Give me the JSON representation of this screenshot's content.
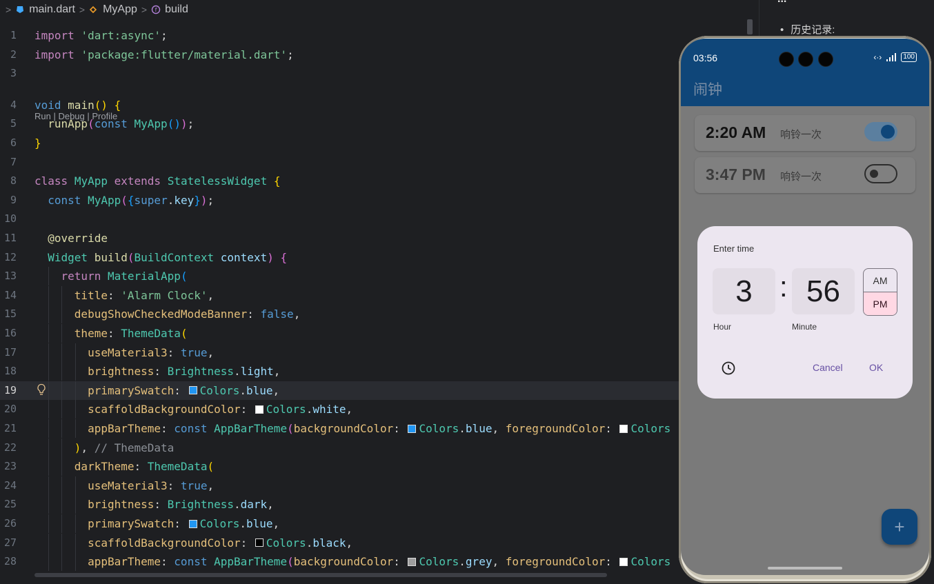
{
  "breadcrumb": {
    "file": "main.dart",
    "class": "MyApp",
    "method": "build"
  },
  "codelens": "Run | Debug | Profile",
  "doc_panel": {
    "heading": "...",
    "history": "历史记录:"
  },
  "lines": [
    {
      "n": "1",
      "html": "<span class='kw'>import</span> <span class='str'>'dart:async'</span>;"
    },
    {
      "n": "2",
      "html": "<span class='kw'>import</span> <span class='str'>'package:flutter/material.dart'</span>;"
    },
    {
      "n": "3",
      "html": ""
    },
    {
      "n": "4",
      "html": "<span class='kw2'>void</span> <span class='fn'>main</span><span class='p1'>()</span> <span class='p1'>{</span>"
    },
    {
      "n": "5",
      "html": "  <span class='fn'>runApp</span><span class='p2'>(</span><span class='kw2'>const</span> <span class='cls'>MyApp</span><span class='p3'>()</span><span class='p2'>)</span>;"
    },
    {
      "n": "6",
      "html": "<span class='p1'>}</span>"
    },
    {
      "n": "7",
      "html": ""
    },
    {
      "n": "8",
      "html": "<span class='kw'>class</span> <span class='cls'>MyApp</span> <span class='kw'>extends</span> <span class='cls'>StatelessWidget</span> <span class='p1'>{</span>"
    },
    {
      "n": "9",
      "html": "  <span class='kw2'>const</span> <span class='cls'>MyApp</span><span class='p2'>(</span><span class='p3'>{</span><span class='kw2'>super</span>.<span class='var'>key</span><span class='p3'>}</span><span class='p2'>)</span>;"
    },
    {
      "n": "10",
      "html": ""
    },
    {
      "n": "11",
      "html": "  <span class='fn'>@override</span>"
    },
    {
      "n": "12",
      "html": "  <span class='cls'>Widget</span> <span class='fn'>build</span><span class='p2'>(</span><span class='cls'>BuildContext</span> <span class='var'>context</span><span class='p2'>)</span> <span class='p2'>{</span>"
    },
    {
      "n": "13",
      "html": "    <span class='kw'>return</span> <span class='cls'>MaterialApp</span><span class='p3'>(</span>"
    },
    {
      "n": "14",
      "html": "      <span class='prop'>title</span>: <span class='str'>'Alarm Clock'</span>,"
    },
    {
      "n": "15",
      "html": "      <span class='prop'>debugShowCheckedModeBanner</span>: <span class='kw2'>false</span>,"
    },
    {
      "n": "16",
      "html": "      <span class='prop'>theme</span>: <span class='cls'>ThemeData</span><span class='p1'>(</span>"
    },
    {
      "n": "17",
      "html": "        <span class='prop'>useMaterial3</span>: <span class='kw2'>true</span>,"
    },
    {
      "n": "18",
      "html": "        <span class='prop'>brightness</span>: <span class='cls'>Brightness</span>.<span class='var'>light</span>,"
    },
    {
      "n": "19",
      "html": "        <span class='prop'>primarySwatch</span>: <span class='sw' style='background:#2196f3'></span><span class='cls'>Colors</span>.<span class='var'>blue</span>,",
      "current": true
    },
    {
      "n": "20",
      "html": "        <span class='prop'>scaffoldBackgroundColor</span>: <span class='sw' style='background:#ffffff'></span><span class='cls'>Colors</span>.<span class='var'>white</span>,"
    },
    {
      "n": "21",
      "html": "        <span class='prop'>appBarTheme</span>: <span class='kw2'>const</span> <span class='cls'>AppBarTheme</span><span class='p2'>(</span><span class='prop'>backgroundColor</span>: <span class='sw' style='background:#2196f3'></span><span class='cls'>Colors</span>.<span class='var'>blue</span>, <span class='prop'>foregroundColor</span>: <span class='sw' style='background:#ffffff'></span><span class='cls'>Colors</span>"
    },
    {
      "n": "22",
      "html": "      <span class='p1'>)</span>, <span class='cmt'>// ThemeData</span>"
    },
    {
      "n": "23",
      "html": "      <span class='prop'>darkTheme</span>: <span class='cls'>ThemeData</span><span class='p1'>(</span>"
    },
    {
      "n": "24",
      "html": "        <span class='prop'>useMaterial3</span>: <span class='kw2'>true</span>,"
    },
    {
      "n": "25",
      "html": "        <span class='prop'>brightness</span>: <span class='cls'>Brightness</span>.<span class='var'>dark</span>,"
    },
    {
      "n": "26",
      "html": "        <span class='prop'>primarySwatch</span>: <span class='sw' style='background:#2196f3'></span><span class='cls'>Colors</span>.<span class='var'>blue</span>,"
    },
    {
      "n": "27",
      "html": "        <span class='prop'>scaffoldBackgroundColor</span>: <span class='sw' style='background:#000000'></span><span class='cls'>Colors</span>.<span class='var'>black</span>,"
    },
    {
      "n": "28",
      "html": "        <span class='prop'>appBarTheme</span>: <span class='kw2'>const</span> <span class='cls'>AppBarTheme</span><span class='p2'>(</span><span class='prop'>backgroundColor</span>: <span class='sw' style='background:#9e9e9e'></span><span class='cls'>Colors</span>.<span class='var'>grey</span>, <span class='prop'>foregroundColor</span>: <span class='sw' style='background:#ffffff'></span><span class='cls'>Colors</span>"
    }
  ],
  "phone": {
    "status_time": "03:56",
    "battery": "100",
    "app_title": "闹钟",
    "alarms": [
      {
        "time": "2:20 AM",
        "repeat": "响铃一次",
        "enabled": true
      },
      {
        "time": "3:47 PM",
        "repeat": "响铃一次",
        "enabled": false
      }
    ],
    "dialog": {
      "title": "Enter time",
      "hour": "3",
      "minute": "56",
      "separator": ":",
      "hour_label": "Hour",
      "minute_label": "Minute",
      "am": "AM",
      "pm": "PM",
      "cancel": "Cancel",
      "ok": "OK"
    },
    "fab": "+"
  },
  "colors": {
    "app_bar": "#0f4679",
    "editor_bg": "#1e1f22",
    "pm_selected": "#ffd8e4",
    "dialog_bg": "#ece6f0"
  }
}
